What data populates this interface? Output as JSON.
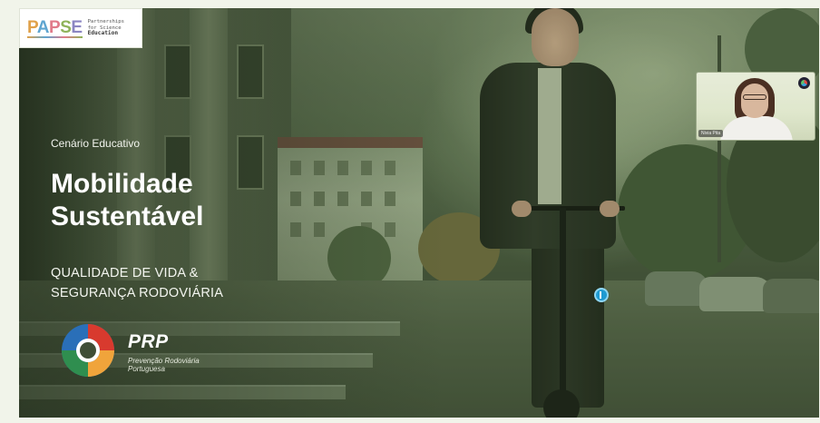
{
  "partner_logo": {
    "mark": [
      "P",
      "A",
      "P",
      "S",
      "E"
    ],
    "line1": "Partnerships",
    "line2": "for Science",
    "line3": "Education"
  },
  "slide": {
    "kicker": "Cenário Educativo",
    "title_line1": "Mobilidade",
    "title_line2": "Sustentável",
    "tagline_line1": "QUALIDADE DE VIDA &",
    "tagline_line2": "SEGURANÇA RODOVIÁRIA"
  },
  "prp_logo": {
    "acronym": "PRP",
    "full_line1": "Prevenção Rodoviária",
    "full_line2": "Portuguesa",
    "colors": [
      "#d83a2e",
      "#f0a43b",
      "#2f8e4f",
      "#2a6fb8"
    ]
  },
  "video_tile": {
    "participant_name": "Nivia Pita",
    "badge_icon": "app-logo-icon"
  },
  "cursor": {
    "icon": "pointer-marker-icon",
    "color": "#1f9ad1"
  }
}
